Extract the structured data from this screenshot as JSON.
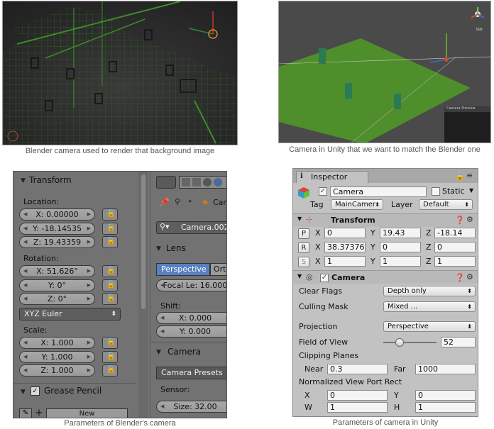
{
  "captions": {
    "top_left": "Blender camera used to render that background image",
    "top_right": "Camera in Unity that we want to match the Blender one",
    "bottom_left": "Parameters of Blender's camera",
    "bottom_right": "Parameters of camera in Unity"
  },
  "unity_view": {
    "preview_label": "Camera Preview",
    "gizmo_label": "Iso"
  },
  "blender": {
    "transform_header": "Transform",
    "location_label": "Location:",
    "location": [
      "X: 0.00000",
      "Y: -18.14535",
      "Z: 19.43359"
    ],
    "rotation_label": "Rotation:",
    "rotation": [
      "X: 51.626°",
      "Y: 0°",
      "Z: 0°"
    ],
    "rotation_mode": "XYZ Euler",
    "scale_label": "Scale:",
    "scale": [
      "X: 1.000",
      "Y: 1.000",
      "Z: 1.000"
    ],
    "grease_pencil_header": "Grease Pencil",
    "new_button": "New",
    "breadcrumb_tail": "Camera",
    "camera_datablock": "Camera.002",
    "lens_header": "Lens",
    "perspective_tab": "Perspective",
    "ortho_tab": "Orthogr",
    "focal_length": "Focal Le: 16.000",
    "shift_label": "Shift:",
    "shift": [
      "X: 0.000",
      "Y: 0.000"
    ],
    "camera_header": "Camera",
    "camera_presets": "Camera Presets",
    "sensor_label": "Sensor:",
    "sensor_size": "Size: 32.00"
  },
  "unity": {
    "tab_label": "Inspector",
    "object_name": "Camera",
    "static_label": "Static",
    "tag_label": "Tag",
    "tag_value": "MainCamer",
    "layer_label": "Layer",
    "layer_value": "Default",
    "transform_header": "Transform",
    "position": {
      "label": "P",
      "x": "0",
      "y": "19.43",
      "z": "-18.14"
    },
    "rotation": {
      "label": "R",
      "x": "38.37376",
      "y": "0",
      "z": "0"
    },
    "scale": {
      "label": "S",
      "x": "1",
      "y": "1",
      "z": "1"
    },
    "axis_x": "X",
    "axis_y": "Y",
    "axis_z": "Z",
    "camera_header": "Camera",
    "clear_flags_label": "Clear Flags",
    "clear_flags_value": "Depth only",
    "culling_mask_label": "Culling Mask",
    "culling_mask_value": "Mixed ...",
    "projection_label": "Projection",
    "projection_value": "Perspective",
    "fov_label": "Field of View",
    "fov_value": "52",
    "fov_slider_fraction": 0.3,
    "clipping_label": "Clipping Planes",
    "near_label": "Near",
    "near_value": "0.3",
    "far_label": "Far",
    "far_value": "1000",
    "viewport_label": "Normalized View Port Rect",
    "vp_x_label": "X",
    "vp_x": "0",
    "vp_y_label": "Y",
    "vp_y": "0",
    "vp_w_label": "W",
    "vp_w": "1",
    "vp_h_label": "H",
    "vp_h": "1"
  }
}
